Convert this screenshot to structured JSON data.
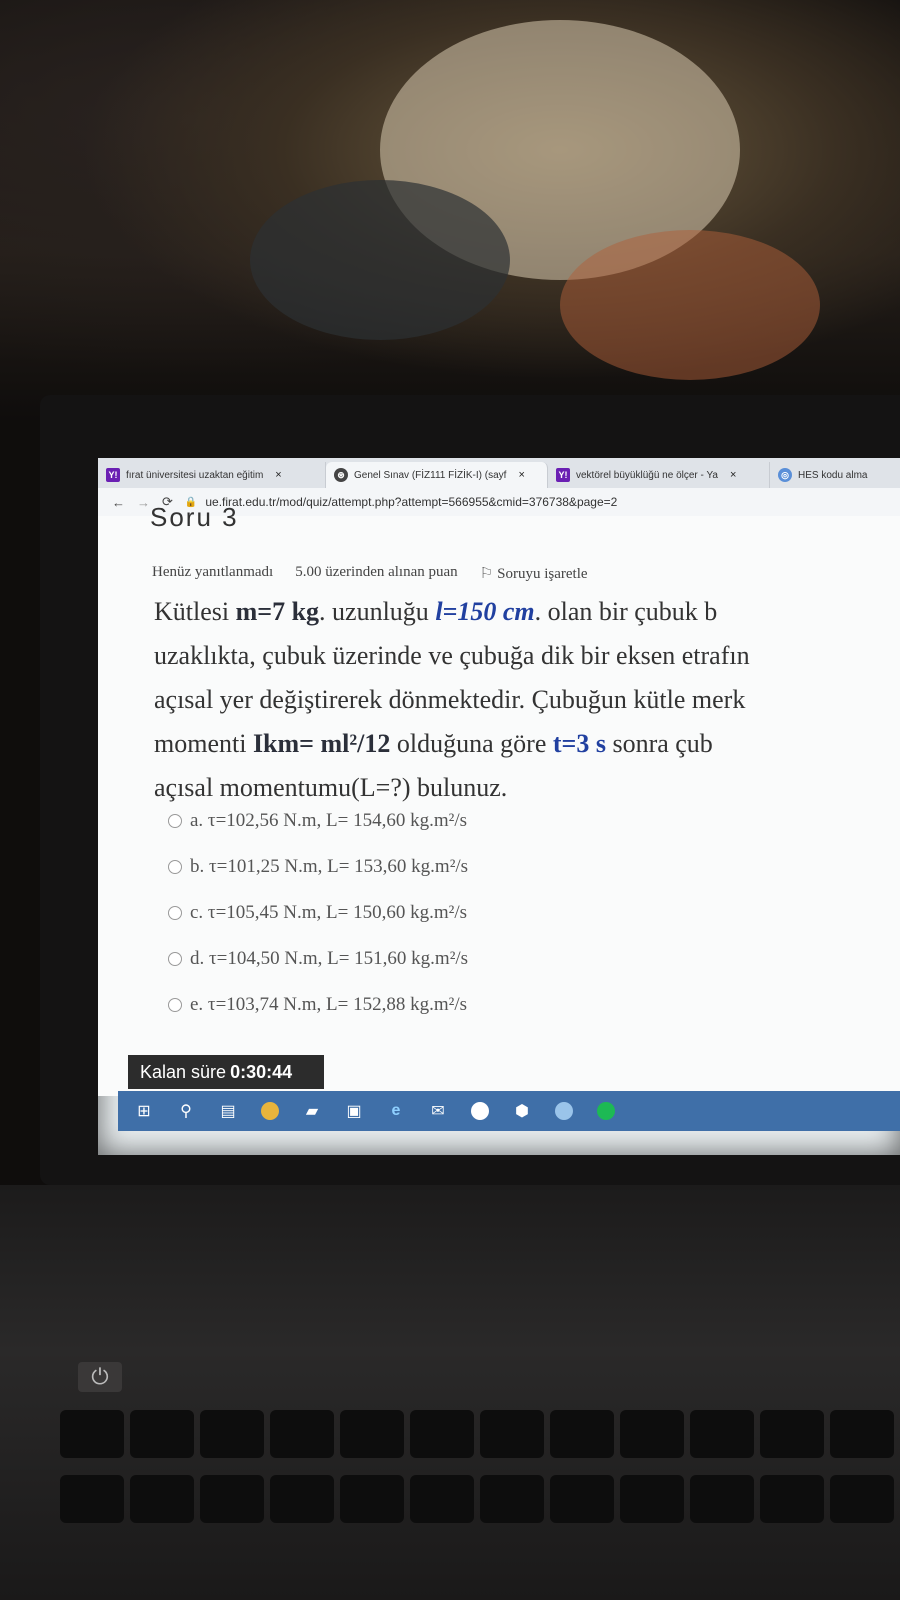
{
  "browser": {
    "tabs": [
      {
        "favicon": "Y!",
        "title": "fırat üniversitesi uzaktan eğitim",
        "close": "×"
      },
      {
        "favicon": "⊛",
        "title": "Genel Sınav (FİZ111 FİZİK-I) (sayf",
        "close": "×"
      },
      {
        "favicon": "Y!",
        "title": "vektörel büyüklüğü ne ölçer - Ya",
        "close": "×"
      },
      {
        "favicon": "◎",
        "title": "HES kodu alma",
        "close": ""
      }
    ],
    "url": "ue.firat.edu.tr/mod/quiz/attempt.php?attempt=566955&cmid=376738&page=2"
  },
  "quiz": {
    "heading": "Soru 3",
    "status": "Henüz yanıtlanmadı",
    "points": "5.00 üzerinden alınan puan",
    "flag_label": "Soruyu işaretle",
    "question": {
      "line1": {
        "pre": "Kütlesi ",
        "mass": "m=7 kg",
        "mid": ". uzunluğu ",
        "length": "l=150 cm",
        "post": ".  olan bir çubuk b"
      },
      "line2": "uzaklıkta, çubuk üzerinde ve çubuğa dik bir eksen etrafın",
      "line3": "açısal yer değiştirerek dönmektedir. Çubuğun kütle merk",
      "line4": {
        "pre": "momenti  ",
        "inertia": "Ikm= ml²/12",
        "mid": "  olduğuna göre  ",
        "time": "t=3 s",
        "post": "  sonra çub"
      },
      "line5": "açısal momentumu(L=?) bulunuz."
    },
    "answers": [
      {
        "label": "a. τ=102,56 N.m,  L= 154,60 kg.m²/s"
      },
      {
        "label": "b. τ=101,25 N.m,  L= 153,60 kg.m²/s"
      },
      {
        "label": "c. τ=105,45 N.m,  L= 150,60 kg.m²/s"
      },
      {
        "label": "d. τ=104,50 N.m,  L= 151,60 kg.m²/s"
      },
      {
        "label": "e. τ=103,74 N.m,  L= 152,88 kg.m²/s"
      }
    ],
    "timer_label": "Kalan süre",
    "timer_value": "0:30:44"
  },
  "taskbar": {
    "icons": [
      "windows-icon",
      "search-icon",
      "task-view-icon",
      "chrome-icon",
      "file-explorer-icon",
      "store-icon",
      "edge-icon",
      "mail-icon",
      "yandex-icon",
      "app-icon",
      "browser-icon",
      "spotify-icon"
    ]
  }
}
